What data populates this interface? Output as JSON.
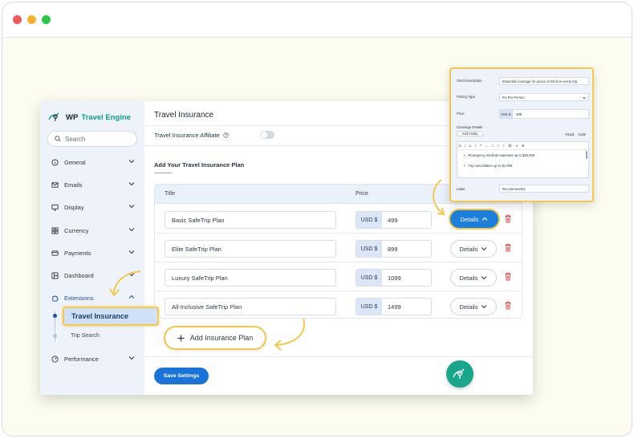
{
  "colors": {
    "accent": "#1a73d9",
    "highlight": "#f2c94c",
    "brand": "#1aa68a",
    "danger": "#e0474c"
  },
  "sidebar": {
    "logo_prefix": "WP",
    "logo_brand": "Travel Engine",
    "search_placeholder": "Search",
    "items": [
      {
        "label": "General",
        "icon": "info-icon"
      },
      {
        "label": "Emails",
        "icon": "mail-icon"
      },
      {
        "label": "Display",
        "icon": "monitor-icon"
      },
      {
        "label": "Currency",
        "icon": "grid-icon"
      },
      {
        "label": "Payments",
        "icon": "card-icon"
      },
      {
        "label": "Dashboard",
        "icon": "dashboard-icon"
      },
      {
        "label": "Extensions",
        "icon": "puzzle-icon"
      }
    ],
    "sub_items": [
      {
        "label": "Travel Insurance",
        "active": true
      },
      {
        "label": "Trip Search",
        "active": false
      }
    ],
    "bottom_item": {
      "label": "Performance",
      "icon": "gauge-icon"
    }
  },
  "main": {
    "title": "Travel Insurance",
    "affiliate_label": "Travel Insurance Affiliate",
    "section_title": "Add Your Travel Insurance Plan",
    "columns": {
      "title": "Title",
      "price": "Price"
    },
    "rows": [
      {
        "title": "Basic SafeTrip Plan",
        "currency": "USD $",
        "price": "499",
        "details": "Details"
      },
      {
        "title": "Elite SafeTrip Plan",
        "currency": "USD $",
        "price": "899",
        "details": "Details"
      },
      {
        "title": "Luxury SafeTrip Plan",
        "currency": "USD $",
        "price": "1099",
        "details": "Details"
      },
      {
        "title": "All-Inclusive SafeTrip Plan",
        "currency": "USD $",
        "price": "1499",
        "details": "Details"
      }
    ],
    "add_plan_label": "Add Insurance Plan",
    "save_label": "Save Settings"
  },
  "popup": {
    "short_desc_label": "Short description",
    "short_desc_value": "Essential coverage for peace of mind on every trip.",
    "pricing_type_label": "Pricing Type",
    "pricing_type_value": "Fix Per Person",
    "price_label": "Price",
    "currency": "USD $",
    "price_value": "499",
    "coverage_label": "Coverage Details",
    "add_media": "Add media",
    "tab_visual": "Visual",
    "tab_code": "Code",
    "bullets": [
      "Emergency medical expenses up to $25,000",
      "Trip cancellation up to $1,000"
    ],
    "label_label": "Label",
    "label_value": "Recommended"
  }
}
